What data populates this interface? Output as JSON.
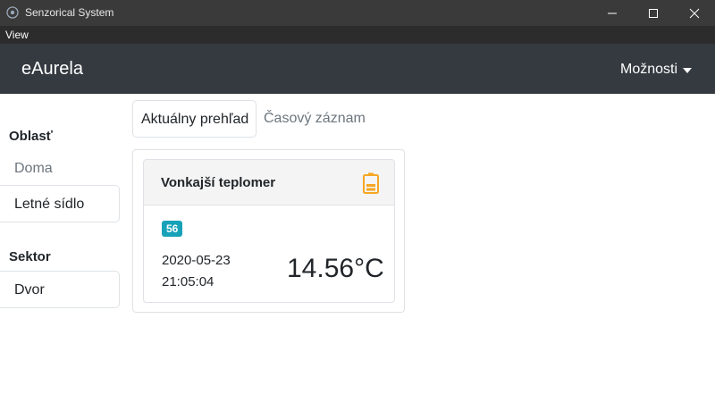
{
  "window": {
    "title": "Senzorical System",
    "menu": [
      "View"
    ]
  },
  "navbar": {
    "brand": "eAurela",
    "options_label": "Možnosti"
  },
  "sidebar": {
    "area_heading": "Oblasť",
    "areas": [
      {
        "label": "Doma",
        "selected": false
      },
      {
        "label": "Letné sídlo",
        "selected": true
      }
    ],
    "sector_heading": "Sektor",
    "sectors": [
      {
        "label": "Dvor",
        "selected": true
      }
    ]
  },
  "tabs": [
    {
      "label": "Aktuálny prehľad",
      "active": true
    },
    {
      "label": "Časový záznam",
      "active": false
    }
  ],
  "sensor": {
    "title": "Vonkajší teplomer",
    "badge": "56",
    "date": "2020-05-23",
    "time": "21:05:04",
    "temperature": "14.56°C",
    "battery_icon": "battery-icon",
    "battery_color": "#f5a623"
  },
  "colors": {
    "titlebar": "#3a3a3a",
    "navbar": "#343a40",
    "badge": "#17a2b8"
  }
}
